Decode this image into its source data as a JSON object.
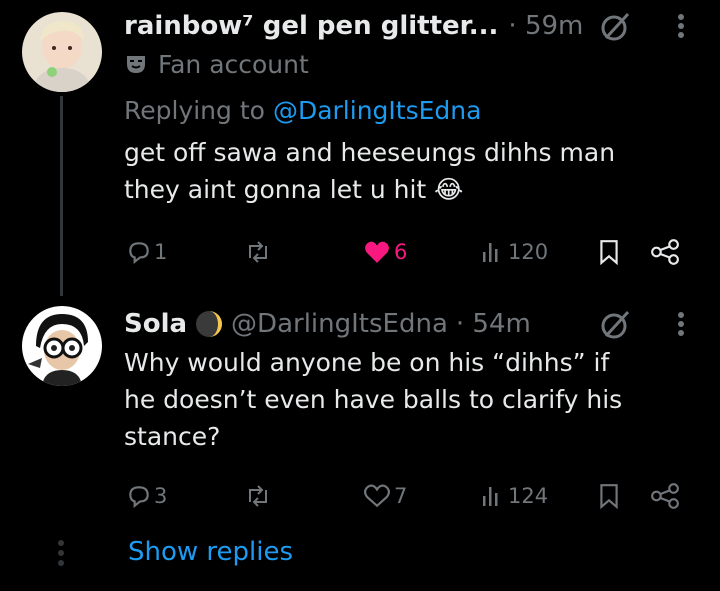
{
  "tweet1": {
    "name": "rainbow⁷ gel pen glitter...",
    "time": "· 59m",
    "label": "Fan account",
    "replying_prefix": "Replying to",
    "replying_handle": "@DarlingItsEdna",
    "text_line1": "get off sawa and heeseungs dihhs man",
    "text_line2": "they aint gonna let u hit",
    "emoji": "😂",
    "replies": "1",
    "likes": "6",
    "views": "120"
  },
  "tweet2": {
    "name": "Sola",
    "handle": "@DarlingItsEdna",
    "time": "· 54m",
    "text_line1": "Why would anyone be on his “dihhs” if",
    "text_line2": "he doesn’t even have balls to clarify his",
    "text_line3": "stance?",
    "replies": "3",
    "likes": "7",
    "views": "124"
  },
  "show_replies": "Show replies",
  "icons": {
    "grok": "grok-icon",
    "more": "more-icon",
    "fan_label": "mask-icon",
    "reply": "reply-icon",
    "retweet": "retweet-icon",
    "like": "heart-icon",
    "views": "views-icon",
    "bookmark": "bookmark-icon",
    "share": "share-icon"
  },
  "colors": {
    "background": "#000000",
    "text": "#e7e9ea",
    "muted": "#71767b",
    "link": "#1d9bf0",
    "like": "#f91880"
  }
}
